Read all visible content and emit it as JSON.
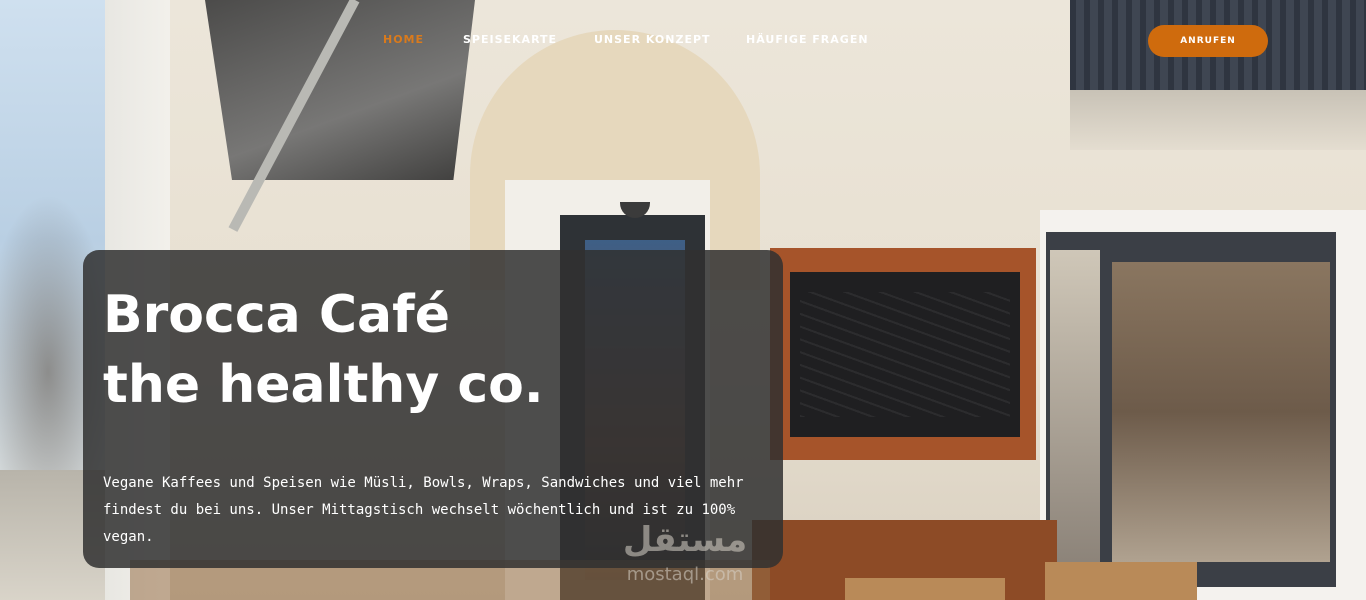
{
  "nav": {
    "items": [
      {
        "label": "HOME",
        "active": true
      },
      {
        "label": "SPEISEKARTE",
        "active": false
      },
      {
        "label": "UNSER KONZEPT",
        "active": false
      },
      {
        "label": "HÄUFIGE FRAGEN",
        "active": false
      }
    ],
    "cta_label": "ANRUFEN"
  },
  "hero": {
    "title_line1": "Brocca Café",
    "title_line2": "the healthy co.",
    "description": "Vegane Kaffees und Speisen wie Müsli, Bowls, Wraps, Sandwiches und viel mehr findest du bei uns. Unser Mittagstisch wechselt wöchentlich und ist zu 100% vegan."
  },
  "watermark": {
    "logo_text": "مستقل",
    "domain": "mostaql.com"
  },
  "colors": {
    "accent": "#cf6b0d",
    "active_nav": "#d97a1c",
    "card_bg": "#303030"
  }
}
